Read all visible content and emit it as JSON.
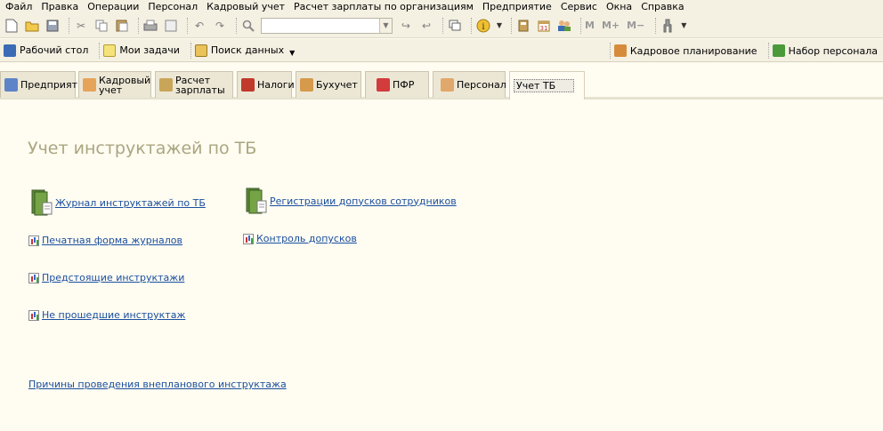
{
  "menu": [
    "Файл",
    "Правка",
    "Операции",
    "Персонал",
    "Кадровый учет",
    "Расчет зарплаты по организациям",
    "Предприятие",
    "Сервис",
    "Окна",
    "Справка"
  ],
  "toolbar": {
    "m": "M",
    "mplus": "M+",
    "mminus": "M−"
  },
  "quickbar": {
    "desktop": "Рабочий стол",
    "tasks": "Мои задачи",
    "search": "Поиск данных",
    "hr_planning": "Кадровое планирование",
    "recruit": "Набор персонала"
  },
  "tabs": [
    {
      "label": "Предприятие"
    },
    {
      "label": "Кадровый учет"
    },
    {
      "label": "Расчет зарплаты"
    },
    {
      "label": "Налоги"
    },
    {
      "label": "Бухучет"
    },
    {
      "label": "ПФР"
    },
    {
      "label": "Персонал"
    },
    {
      "label": "Учет ТБ"
    }
  ],
  "content": {
    "title": "Учет инструктажей по ТБ",
    "journal": "Журнал инструктажей по ТБ",
    "print_form": "Печатная форма журналов",
    "upcoming": "Предстоящие инструктажи",
    "not_passed": "Не прошедшие инструктаж",
    "registration": "Регистрации допусков сотрудников",
    "control": "Контроль допусков",
    "reasons": "Причины проведения внепланового инструктажа"
  }
}
